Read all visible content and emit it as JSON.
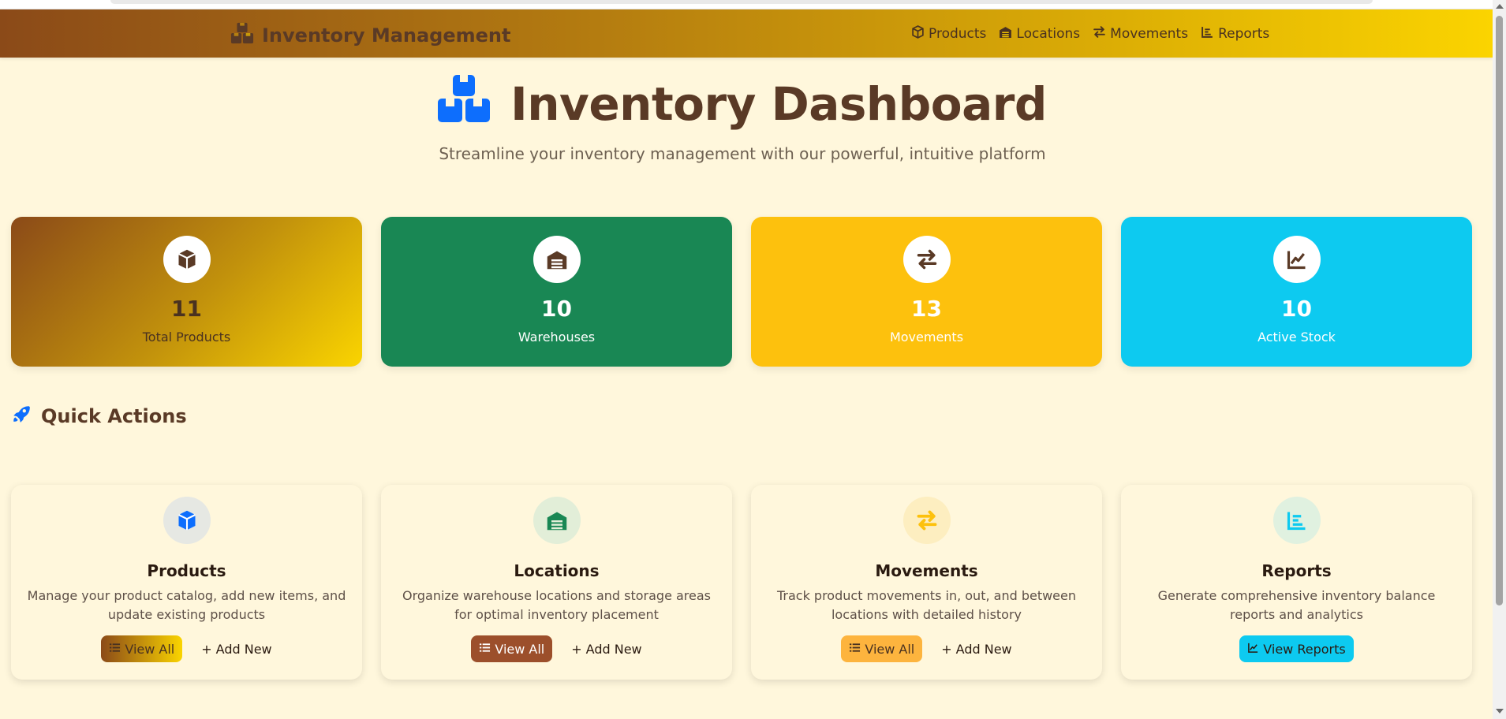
{
  "navbar": {
    "brand": "Inventory Management",
    "links": [
      {
        "label": "Products",
        "icon": "box-icon"
      },
      {
        "label": "Locations",
        "icon": "warehouse-icon"
      },
      {
        "label": "Movements",
        "icon": "arrows-exchange-icon"
      },
      {
        "label": "Reports",
        "icon": "bar-chart-icon"
      }
    ]
  },
  "hero": {
    "title": "Inventory Dashboard",
    "subtitle": "Streamline your inventory management with our powerful, intuitive platform"
  },
  "stats": [
    {
      "value": "11",
      "label": "Total Products",
      "icon": "box-icon"
    },
    {
      "value": "10",
      "label": "Warehouses",
      "icon": "warehouse-icon"
    },
    {
      "value": "13",
      "label": "Movements",
      "icon": "arrows-exchange-icon"
    },
    {
      "value": "10",
      "label": "Active Stock",
      "icon": "line-chart-icon"
    }
  ],
  "quick_actions": {
    "title": "Quick Actions",
    "cards": [
      {
        "title": "Products",
        "description": "Manage your product catalog, add new items, and update existing products",
        "primary": "View All",
        "secondary": "Add New"
      },
      {
        "title": "Locations",
        "description": "Organize warehouse locations and storage areas for optimal inventory placement",
        "primary": "View All",
        "secondary": "Add New"
      },
      {
        "title": "Movements",
        "description": "Track product movements in, out, and between locations with detailed history",
        "primary": "View All",
        "secondary": "Add New"
      },
      {
        "title": "Reports",
        "description": "Generate comprehensive inventory balance reports and analytics",
        "primary": "View Reports"
      }
    ]
  },
  "colors": {
    "brown": "#5a3a26",
    "green": "#198754",
    "yellow": "#fdc10d",
    "cyan": "#0dcaf0",
    "blue": "#0d6efd",
    "background": "#fff7dc"
  }
}
